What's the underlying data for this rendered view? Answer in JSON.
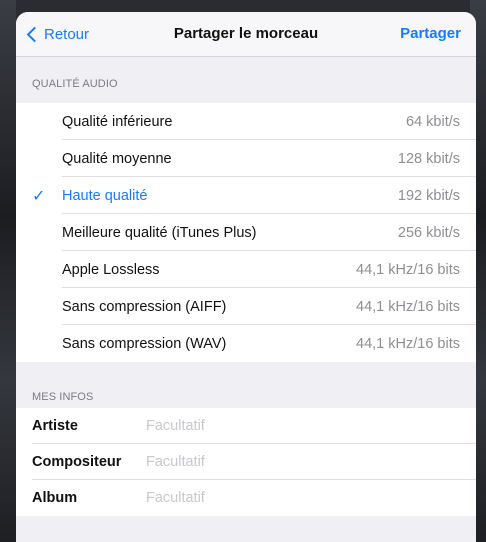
{
  "navbar": {
    "back_label": "Retour",
    "title": "Partager le morceau",
    "action_label": "Partager"
  },
  "audio_quality": {
    "header": "QUALITÉ AUDIO",
    "selected_index": 2,
    "check_glyph": "✓",
    "options": [
      {
        "label": "Qualité inférieure",
        "value": "64 kbit/s"
      },
      {
        "label": "Qualité moyenne",
        "value": "128 kbit/s"
      },
      {
        "label": "Haute qualité",
        "value": "192 kbit/s"
      },
      {
        "label": "Meilleure qualité (iTunes Plus)",
        "value": "256 kbit/s"
      },
      {
        "label": "Apple Lossless",
        "value": "44,1 kHz/16 bits"
      },
      {
        "label": "Sans compression (AIFF)",
        "value": "44,1 kHz/16 bits"
      },
      {
        "label": "Sans compression (WAV)",
        "value": "44,1 kHz/16 bits"
      }
    ]
  },
  "my_info": {
    "header": "MES INFOS",
    "fields": [
      {
        "label": "Artiste",
        "value": "",
        "placeholder": "Facultatif"
      },
      {
        "label": "Compositeur",
        "value": "",
        "placeholder": "Facultatif"
      },
      {
        "label": "Album",
        "value": "",
        "placeholder": "Facultatif"
      }
    ]
  },
  "colors": {
    "accent": "#1a7cf5",
    "grouped_background": "#efeff4",
    "secondary_text": "#8e8e93",
    "placeholder_text": "#c7c7cc"
  }
}
